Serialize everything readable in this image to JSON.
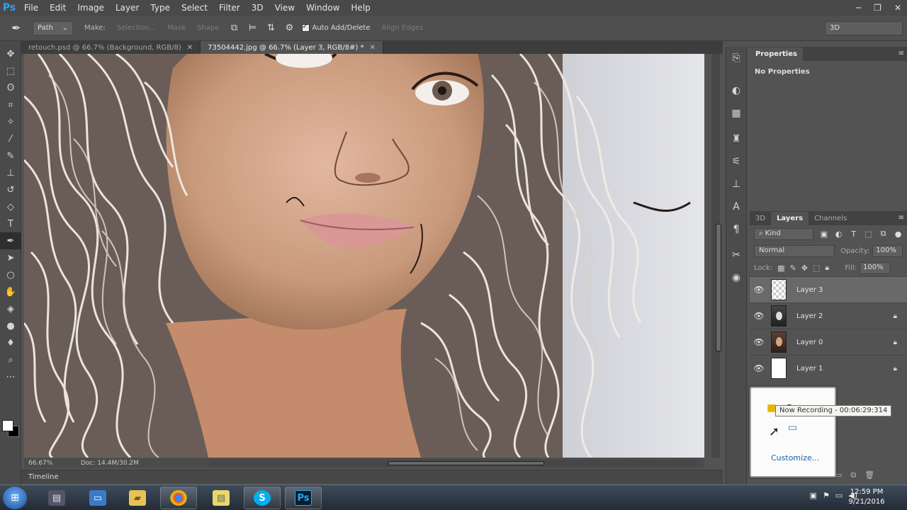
{
  "app": {
    "logo": "Ps"
  },
  "menu": [
    "File",
    "Edit",
    "Image",
    "Layer",
    "Type",
    "Select",
    "Filter",
    "3D",
    "View",
    "Window",
    "Help"
  ],
  "window_controls": [
    "minimize-icon",
    "restore-icon",
    "close-icon"
  ],
  "options": {
    "mode": "Path",
    "make_label": "Make:",
    "selection_btn": "Selection...",
    "mask_btn": "Mask",
    "shape_btn": "Shape",
    "auto_add_delete": "Auto Add/Delete",
    "align_edges": "Align Edges",
    "workspace": "3D"
  },
  "tabs": [
    {
      "title": "retouch.psd @ 66.7% (Background, RGB/8)",
      "active": false
    },
    {
      "title": "73504442.jpg @ 66.7% (Layer 3, RGB/8#) *",
      "active": true
    }
  ],
  "status": {
    "zoom": "66.67%",
    "doc": "Doc: 14.4M/30.2M"
  },
  "timeline_label": "Timeline",
  "properties": {
    "tab": "Properties",
    "empty": "No Properties"
  },
  "layers_panel": {
    "tabs": [
      "3D",
      "Layers",
      "Channels"
    ],
    "kind": "Kind",
    "blend": "Normal",
    "opacity_label": "Opacity:",
    "opacity": "100%",
    "lock_label": "Lock:",
    "fill_label": "Fill:",
    "fill": "100%",
    "layers": [
      {
        "name": "Layer 3",
        "thumb": "check",
        "locked": false,
        "selected": true
      },
      {
        "name": "Layer 2",
        "thumb": "hair",
        "locked": true,
        "selected": false
      },
      {
        "name": "Layer 0",
        "thumb": "face",
        "locked": true,
        "selected": false
      },
      {
        "name": "Layer 1",
        "thumb": "white",
        "locked": true,
        "selected": false
      }
    ]
  },
  "tray_popup": {
    "tooltip": "Now Recording - 00:06:29:314",
    "customize": "Customize..."
  },
  "taskbar": {
    "apps": [
      "file-manager",
      "computer",
      "folder",
      "chrome",
      "sticky-notes",
      "skype",
      "photoshop"
    ],
    "photoshop_label": "Ps",
    "skype_label": "S",
    "time": "12:59 PM",
    "date": "9/21/2016"
  },
  "colors": {
    "accent": "#2fa3ef",
    "panel": "#535353",
    "canvas_bg": "#dfe0e4"
  }
}
